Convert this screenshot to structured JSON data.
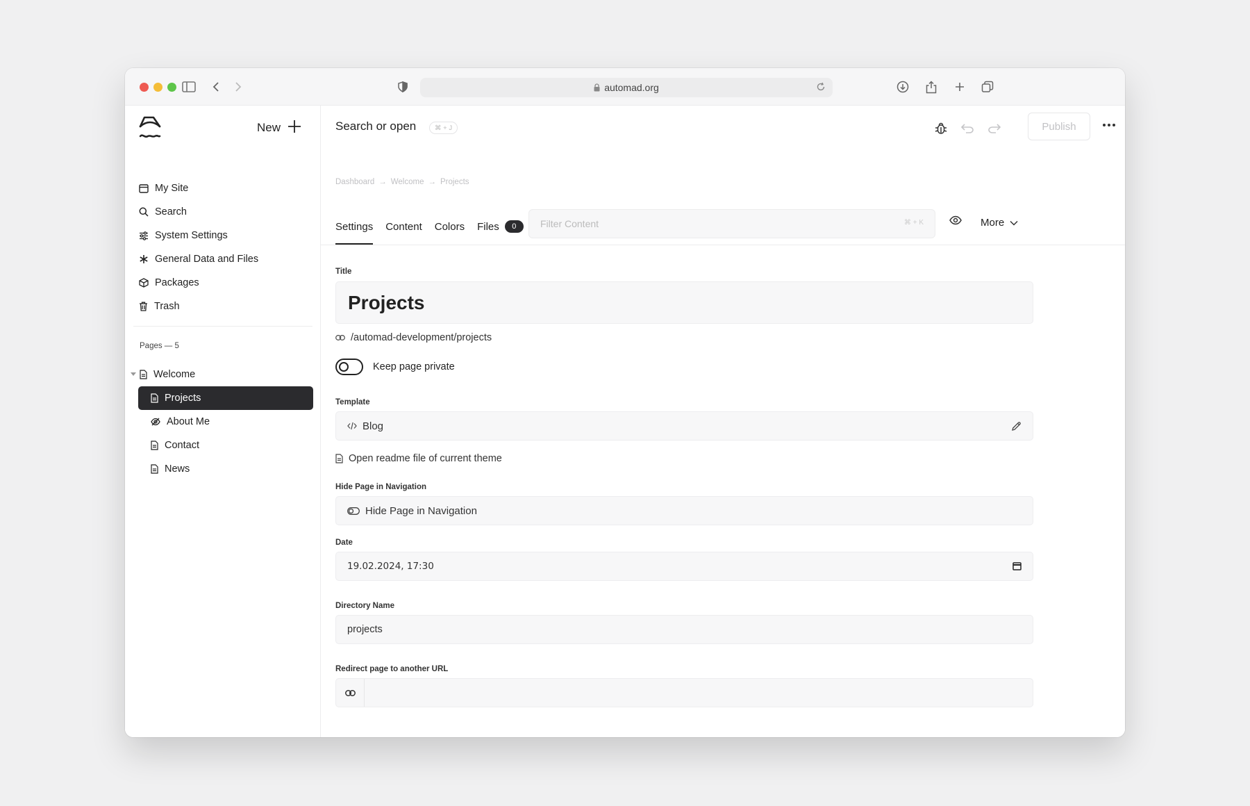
{
  "browser": {
    "url": "automad.org"
  },
  "sidebar": {
    "new_label": "New",
    "nav": [
      {
        "label": "My Site",
        "icon": "window-icon"
      },
      {
        "label": "Search",
        "icon": "search-icon"
      },
      {
        "label": "System Settings",
        "icon": "sliders-icon"
      },
      {
        "label": "General Data and Files",
        "icon": "asterisk-icon"
      },
      {
        "label": "Packages",
        "icon": "package-icon"
      },
      {
        "label": "Trash",
        "icon": "trash-icon"
      }
    ],
    "pages_count": "Pages — 5",
    "tree": [
      {
        "label": "Welcome",
        "icon": "page-icon"
      },
      {
        "label": "Projects",
        "icon": "page-icon",
        "active": true
      },
      {
        "label": "About Me",
        "icon": "eye-slash-icon"
      },
      {
        "label": "Contact",
        "icon": "page-icon"
      },
      {
        "label": "News",
        "icon": "page-icon"
      }
    ]
  },
  "topbar": {
    "search_label": "Search or open",
    "search_shortcut": "⌘ + J",
    "publish_label": "Publish"
  },
  "breadcrumb": [
    "Dashboard",
    "Welcome",
    "Projects"
  ],
  "tabs": {
    "items": [
      "Settings",
      "Content",
      "Colors",
      "Files"
    ],
    "active": "Settings",
    "files_count": "0",
    "filter_placeholder": "Filter Content",
    "filter_shortcut": "⌘ + K",
    "more_label": "More"
  },
  "form": {
    "title_label": "Title",
    "title_value": "Projects",
    "path": "/automad-development/projects",
    "private_label": "Keep page private",
    "template_label": "Template",
    "template_value": "Blog",
    "readme_label": "Open readme file of current theme",
    "hide_label": "Hide Page in Navigation",
    "hide_value": "Hide Page in Navigation",
    "date_label": "Date",
    "date_value": "19.02.2024, 17:30",
    "dir_label": "Directory Name",
    "dir_value": "projects",
    "redirect_label": "Redirect page to another URL",
    "redirect_value": ""
  }
}
